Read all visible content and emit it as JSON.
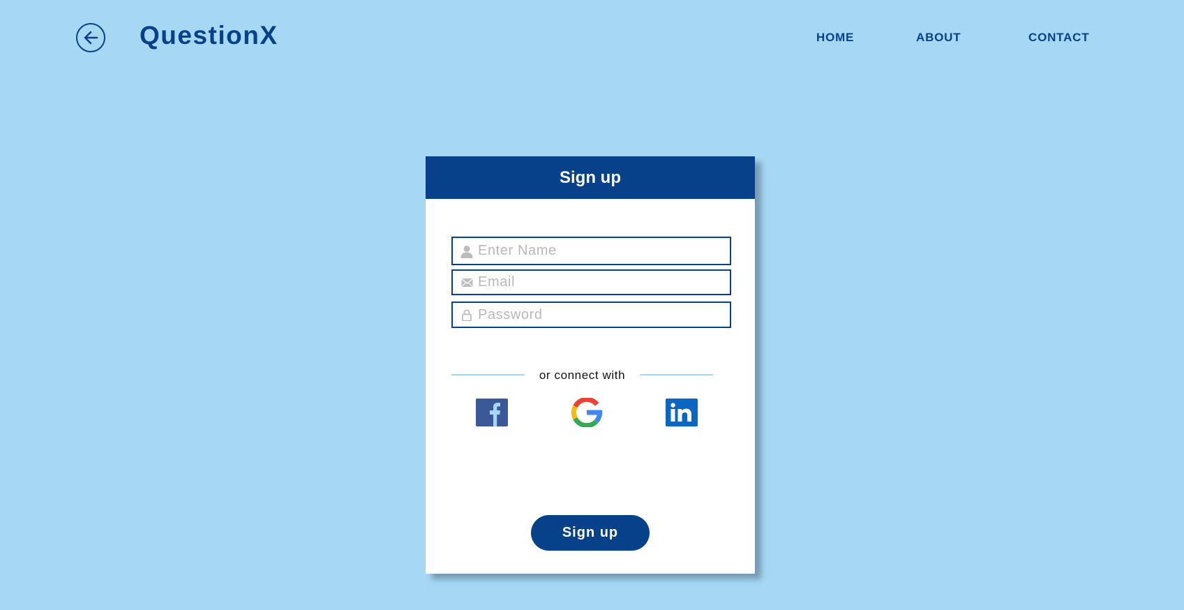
{
  "header": {
    "brand": "QuestionX",
    "nav": {
      "home": "HOME",
      "about": "ABOUT",
      "contact": "CONTACT"
    }
  },
  "signup_card": {
    "title": "Sign up",
    "fields": {
      "name": {
        "placeholder": "Enter Name",
        "value": "",
        "icon": "user-icon"
      },
      "email": {
        "placeholder": "Email",
        "value": "",
        "icon": "mail-icon"
      },
      "password": {
        "placeholder": "Password",
        "value": "",
        "icon": "lock-icon"
      }
    },
    "divider_text": "or connect with",
    "social": [
      "facebook",
      "google",
      "linkedin"
    ],
    "submit_label": "Sign up"
  },
  "colors": {
    "background": "#a6d8f4",
    "primary": "#07418a",
    "card": "#ffffff",
    "placeholder": "#b8b8b8",
    "facebook": "#3b5998",
    "linkedin": "#0a66c2"
  }
}
